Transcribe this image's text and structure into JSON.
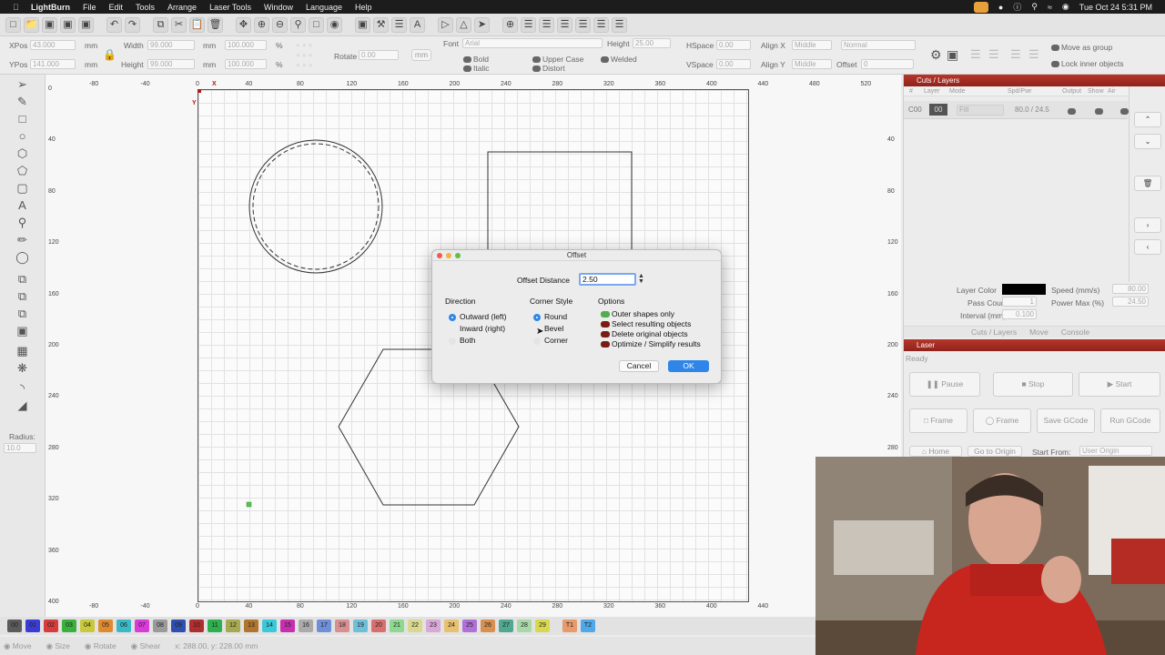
{
  "menubar": {
    "app": "LightBurn",
    "items": [
      "File",
      "Edit",
      "Tools",
      "Arrange",
      "Laser Tools",
      "Window",
      "Language",
      "Help"
    ],
    "clock": "Tue Oct 24  5:31 PM"
  },
  "props": {
    "xpos_label": "XPos",
    "xpos_value": "43.000",
    "ypos_label": "YPos",
    "ypos_value": "141.000",
    "unit": "mm",
    "width_label": "Width",
    "width_value": "99.000",
    "height_label": "Height",
    "height_value": "99.000",
    "pct_value": "100.000",
    "pct_unit": "%",
    "rotate_label": "Rotate",
    "rotate_value": "0.00",
    "rotate_unit": "mm",
    "font_label": "Font",
    "font_value": "Arial",
    "text_height_label": "Height",
    "text_height_value": "25.00",
    "hspace_label": "HSpace",
    "hspace_value": "0.00",
    "vspace_label": "VSpace",
    "vspace_value": "0.00",
    "alignx_label": "Align X",
    "alignx_value": "Middle",
    "aligny_label": "Align Y",
    "aligny_value": "Middle",
    "normal_value": "Normal",
    "offset_label": "Offset",
    "offset_value": "0",
    "bold": "Bold",
    "italic": "Italic",
    "upper": "Upper Case",
    "distort": "Distort",
    "welded": "Welded",
    "move_group": "Move as group",
    "lock_inner": "Lock inner objects"
  },
  "tools": {
    "radius_label": "Radius:",
    "radius_value": "10.0"
  },
  "rulers": {
    "top": [
      "-80",
      "-40",
      "0",
      "40",
      "80",
      "120",
      "160",
      "200",
      "240",
      "280",
      "320",
      "360",
      "400",
      "440",
      "480",
      "520"
    ],
    "bottom": [
      "-80",
      "-40",
      "0",
      "40",
      "80",
      "120",
      "160",
      "200",
      "240",
      "280",
      "320",
      "360",
      "400",
      "440"
    ],
    "left": [
      "0",
      "40",
      "80",
      "120",
      "160",
      "200",
      "240",
      "280",
      "320",
      "360",
      "400"
    ],
    "right": [
      "40",
      "80",
      "120",
      "160",
      "200",
      "240",
      "280"
    ],
    "x_marker": "X",
    "y_marker": "Y"
  },
  "cuts": {
    "title": "Cuts / Layers",
    "headers": [
      "#",
      "Layer",
      "Mode",
      "Spd/Pwr",
      "Output",
      "Show",
      "Air"
    ],
    "row": {
      "id": "C00",
      "layer": "00",
      "mode": "Fill",
      "spdpwr": "80.0 / 24.5"
    },
    "layer_color_label": "Layer Color",
    "speed_label": "Speed (mm/s)",
    "speed_value": "80.00",
    "pass_label": "Pass Count",
    "pass_value": "1",
    "power_label": "Power Max (%)",
    "power_value": "24.50",
    "interval_label": "Interval (mm)",
    "interval_value": "0.100",
    "tabs": [
      "Cuts / Layers",
      "Move",
      "Console"
    ],
    "layer_color": "#000000"
  },
  "laser": {
    "title": "Laser",
    "status": "Ready",
    "pause": "Pause",
    "stop": "Stop",
    "start": "Start",
    "frame1": "Frame",
    "frame2": "Frame",
    "save_gcode": "Save GCode",
    "run_gcode": "Run GCode",
    "home": "Home",
    "go_origin": "Go to Origin",
    "start_from": "Start From:",
    "user_origin": "User Origin"
  },
  "dialog": {
    "title": "Offset",
    "distance_label": "Offset Distance",
    "distance_value": "2.50",
    "direction_label": "Direction",
    "direction_options": [
      "Outward (left)",
      "Inward (right)",
      "Both"
    ],
    "corner_label": "Corner Style",
    "corner_options": [
      "Round",
      "Bevel",
      "Corner"
    ],
    "options_label": "Options",
    "options": [
      "Outer shapes only",
      "Select resulting objects",
      "Delete original objects",
      "Optimize / Simplify results"
    ],
    "cancel": "Cancel",
    "ok": "OK"
  },
  "palette": [
    "00",
    "01",
    "02",
    "03",
    "04",
    "05",
    "06",
    "07",
    "08",
    "09",
    "10",
    "11",
    "12",
    "13",
    "14",
    "15",
    "16",
    "17",
    "18",
    "19",
    "20",
    "21",
    "22",
    "23",
    "24",
    "25",
    "26",
    "27",
    "28",
    "29",
    "T1",
    "T2"
  ],
  "palette_colors": [
    "#5b5b5b",
    "#3b3bd8",
    "#d83b3b",
    "#3bb03b",
    "#c8c83b",
    "#e08a2e",
    "#3bb8c8",
    "#d83bd8",
    "#9a9a9a",
    "#2e4fb0",
    "#b02e2e",
    "#2eb04f",
    "#a8a84f",
    "#b0752e",
    "#3bc8d8",
    "#c82eb0",
    "#aaaaaa",
    "#6f8fd8",
    "#d88f8f",
    "#6fbfd8",
    "#d86f6f",
    "#8fd88f",
    "#d8d88f",
    "#d8a8d8",
    "#e8c070",
    "#b070d8",
    "#d88f4f",
    "#4fa88f",
    "#a8d8a8",
    "#d8d84f",
    "#e89a6a",
    "#4fa8e8"
  ],
  "status": {
    "move": "Move",
    "size": "Size",
    "rotate": "Rotate",
    "shear": "Shear",
    "coords": "x: 288.00, y: 228.00 mm"
  }
}
